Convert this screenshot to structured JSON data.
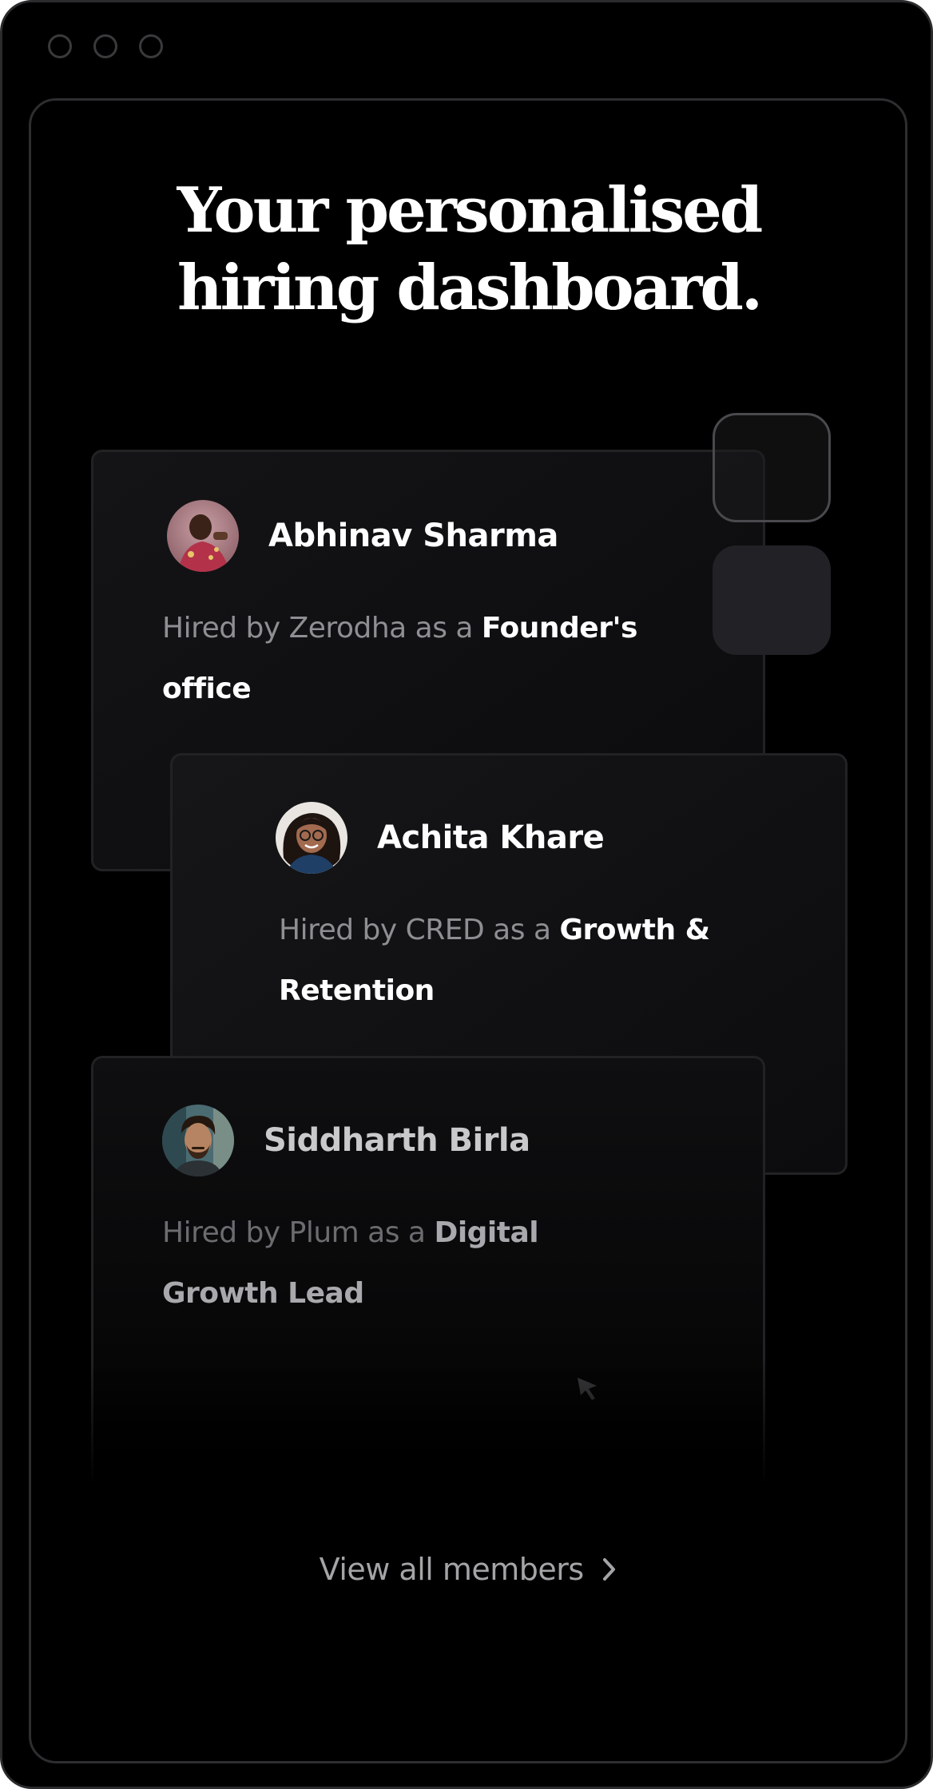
{
  "window": {
    "controls": [
      "window-dot-1",
      "window-dot-2",
      "window-dot-3"
    ]
  },
  "heading": {
    "line1": "Your personalised",
    "line2": "hiring dashboard."
  },
  "members": [
    {
      "name": "Abhinav Sharma",
      "hired_prefix": "Hired by Zerodha as a ",
      "role": "Founder's office",
      "avatar_icon": "avatar-photo"
    },
    {
      "name": "Achita Khare",
      "hired_prefix": "Hired by CRED as a ",
      "role": "Growth & Retention",
      "avatar_icon": "avatar-photo"
    },
    {
      "name": "Siddharth Birla",
      "hired_prefix": "Hired by Plum as a ",
      "role": "Digital Growth Lead",
      "avatar_icon": "avatar-photo"
    }
  ],
  "footer": {
    "view_all_label": "View all members",
    "view_all_icon": "chevron-right-icon"
  },
  "colors": {
    "background": "#000000",
    "card": "#141416",
    "text_primary": "#ffffff",
    "text_secondary": "#8e8e93"
  }
}
